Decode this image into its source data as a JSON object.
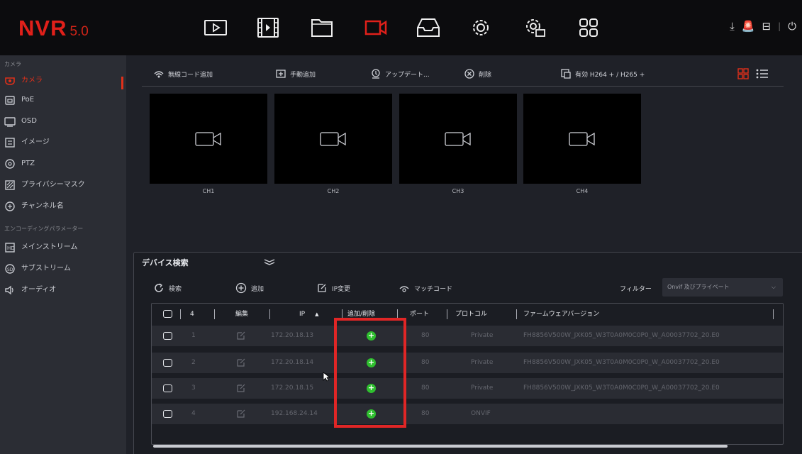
{
  "app": {
    "logo_main": "NVR",
    "logo_version": "5.0"
  },
  "top_nav": [
    "playback-icon",
    "video-clip-icon",
    "folder-icon",
    "camera-icon",
    "storage-icon",
    "settings-icon",
    "system-settings-icon",
    "apps-grid-icon"
  ],
  "top_right": {
    "download": "⤓",
    "alarm": "🚨",
    "storage": "⊟",
    "separator": "|",
    "power": "⏻"
  },
  "sidebar": {
    "section_camera": "カメラ",
    "items": [
      {
        "label": "カメラ",
        "icon": "camera-icon",
        "active": true
      },
      {
        "label": "PoE",
        "icon": "poe-icon"
      },
      {
        "label": "OSD",
        "icon": "osd-icon"
      },
      {
        "label": "イメージ",
        "icon": "image-icon"
      },
      {
        "label": "PTZ",
        "icon": "ptz-icon"
      },
      {
        "label": "プライバシーマスク",
        "icon": "privacy-mask-icon"
      },
      {
        "label": "チャンネル名",
        "icon": "channel-name-icon"
      }
    ],
    "section_encoding": "エンコーディングパラメーター",
    "items2": [
      {
        "label": "メインストリーム",
        "icon": "mainstream-icon"
      },
      {
        "label": "サブストリーム",
        "icon": "substream-icon"
      },
      {
        "label": "オーディオ",
        "icon": "audio-icon"
      }
    ]
  },
  "toolbar": {
    "wireless_add": "無線コード追加",
    "manual_add": "手動追加",
    "update": "アップデート...",
    "delete": "削除",
    "h265": "有効 H264 + / H265 +"
  },
  "channels": [
    "CH1",
    "CH2",
    "CH3",
    "CH4"
  ],
  "device_search": {
    "title": "デバイス検索",
    "search": "検索",
    "add": "追加",
    "ip_change": "IP変更",
    "match_code": "マッチコード",
    "filter_label": "フィルター",
    "filter_value": "Onvif 及びプライベート",
    "columns": {
      "count": "4",
      "edit": "編集",
      "ip": "IP",
      "add_delete": "追加/削除",
      "port": "ポート",
      "protocol": "プロトコル",
      "firmware": "ファームウェアバージョン"
    },
    "rows": [
      {
        "no": "1",
        "ip": "172.20.18.13",
        "port": "80",
        "protocol": "Private",
        "firmware": "FH8856V500W_JXK05_W3T0A0M0C0P0_W_A00037702_20.E0"
      },
      {
        "no": "2",
        "ip": "172.20.18.14",
        "port": "80",
        "protocol": "Private",
        "firmware": "FH8856V500W_JXK05_W3T0A0M0C0P0_W_A00037702_20.E0"
      },
      {
        "no": "3",
        "ip": "172.20.18.15",
        "port": "80",
        "protocol": "Private",
        "firmware": "FH8856V500W_JXK05_W3T0A0M0C0P0_W_A00037702_20.E0"
      },
      {
        "no": "4",
        "ip": "192.168.24.14",
        "port": "80",
        "protocol": "ONVIF",
        "firmware": ""
      }
    ]
  },
  "colors": {
    "accent": "#e0201a",
    "add_green": "#2fbf2f",
    "highlight": "#e02626"
  }
}
